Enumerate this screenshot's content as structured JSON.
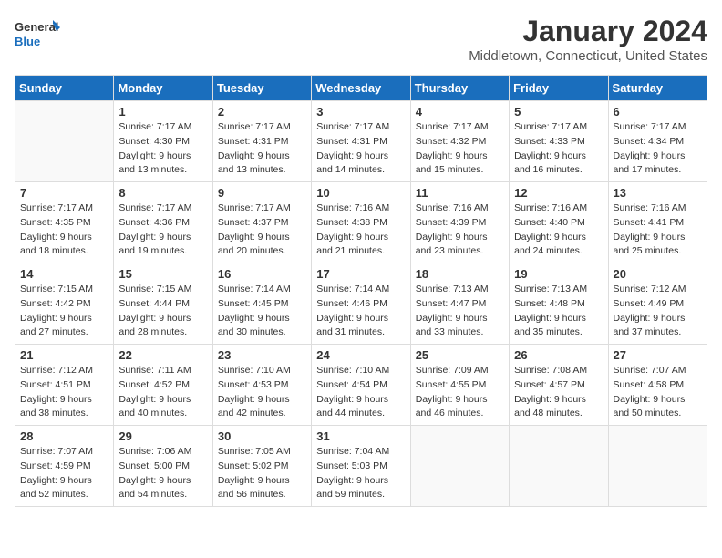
{
  "header": {
    "logo_line1": "General",
    "logo_line2": "Blue",
    "month": "January 2024",
    "location": "Middletown, Connecticut, United States"
  },
  "days_of_week": [
    "Sunday",
    "Monday",
    "Tuesday",
    "Wednesday",
    "Thursday",
    "Friday",
    "Saturday"
  ],
  "weeks": [
    [
      {
        "day": "",
        "empty": true
      },
      {
        "day": "1",
        "sunrise": "7:17 AM",
        "sunset": "4:30 PM",
        "daylight": "9 hours and 13 minutes."
      },
      {
        "day": "2",
        "sunrise": "7:17 AM",
        "sunset": "4:31 PM",
        "daylight": "9 hours and 13 minutes."
      },
      {
        "day": "3",
        "sunrise": "7:17 AM",
        "sunset": "4:31 PM",
        "daylight": "9 hours and 14 minutes."
      },
      {
        "day": "4",
        "sunrise": "7:17 AM",
        "sunset": "4:32 PM",
        "daylight": "9 hours and 15 minutes."
      },
      {
        "day": "5",
        "sunrise": "7:17 AM",
        "sunset": "4:33 PM",
        "daylight": "9 hours and 16 minutes."
      },
      {
        "day": "6",
        "sunrise": "7:17 AM",
        "sunset": "4:34 PM",
        "daylight": "9 hours and 17 minutes."
      }
    ],
    [
      {
        "day": "7",
        "sunrise": "7:17 AM",
        "sunset": "4:35 PM",
        "daylight": "9 hours and 18 minutes."
      },
      {
        "day": "8",
        "sunrise": "7:17 AM",
        "sunset": "4:36 PM",
        "daylight": "9 hours and 19 minutes."
      },
      {
        "day": "9",
        "sunrise": "7:17 AM",
        "sunset": "4:37 PM",
        "daylight": "9 hours and 20 minutes."
      },
      {
        "day": "10",
        "sunrise": "7:16 AM",
        "sunset": "4:38 PM",
        "daylight": "9 hours and 21 minutes."
      },
      {
        "day": "11",
        "sunrise": "7:16 AM",
        "sunset": "4:39 PM",
        "daylight": "9 hours and 23 minutes."
      },
      {
        "day": "12",
        "sunrise": "7:16 AM",
        "sunset": "4:40 PM",
        "daylight": "9 hours and 24 minutes."
      },
      {
        "day": "13",
        "sunrise": "7:16 AM",
        "sunset": "4:41 PM",
        "daylight": "9 hours and 25 minutes."
      }
    ],
    [
      {
        "day": "14",
        "sunrise": "7:15 AM",
        "sunset": "4:42 PM",
        "daylight": "9 hours and 27 minutes."
      },
      {
        "day": "15",
        "sunrise": "7:15 AM",
        "sunset": "4:44 PM",
        "daylight": "9 hours and 28 minutes."
      },
      {
        "day": "16",
        "sunrise": "7:14 AM",
        "sunset": "4:45 PM",
        "daylight": "9 hours and 30 minutes."
      },
      {
        "day": "17",
        "sunrise": "7:14 AM",
        "sunset": "4:46 PM",
        "daylight": "9 hours and 31 minutes."
      },
      {
        "day": "18",
        "sunrise": "7:13 AM",
        "sunset": "4:47 PM",
        "daylight": "9 hours and 33 minutes."
      },
      {
        "day": "19",
        "sunrise": "7:13 AM",
        "sunset": "4:48 PM",
        "daylight": "9 hours and 35 minutes."
      },
      {
        "day": "20",
        "sunrise": "7:12 AM",
        "sunset": "4:49 PM",
        "daylight": "9 hours and 37 minutes."
      }
    ],
    [
      {
        "day": "21",
        "sunrise": "7:12 AM",
        "sunset": "4:51 PM",
        "daylight": "9 hours and 38 minutes."
      },
      {
        "day": "22",
        "sunrise": "7:11 AM",
        "sunset": "4:52 PM",
        "daylight": "9 hours and 40 minutes."
      },
      {
        "day": "23",
        "sunrise": "7:10 AM",
        "sunset": "4:53 PM",
        "daylight": "9 hours and 42 minutes."
      },
      {
        "day": "24",
        "sunrise": "7:10 AM",
        "sunset": "4:54 PM",
        "daylight": "9 hours and 44 minutes."
      },
      {
        "day": "25",
        "sunrise": "7:09 AM",
        "sunset": "4:55 PM",
        "daylight": "9 hours and 46 minutes."
      },
      {
        "day": "26",
        "sunrise": "7:08 AM",
        "sunset": "4:57 PM",
        "daylight": "9 hours and 48 minutes."
      },
      {
        "day": "27",
        "sunrise": "7:07 AM",
        "sunset": "4:58 PM",
        "daylight": "9 hours and 50 minutes."
      }
    ],
    [
      {
        "day": "28",
        "sunrise": "7:07 AM",
        "sunset": "4:59 PM",
        "daylight": "9 hours and 52 minutes."
      },
      {
        "day": "29",
        "sunrise": "7:06 AM",
        "sunset": "5:00 PM",
        "daylight": "9 hours and 54 minutes."
      },
      {
        "day": "30",
        "sunrise": "7:05 AM",
        "sunset": "5:02 PM",
        "daylight": "9 hours and 56 minutes."
      },
      {
        "day": "31",
        "sunrise": "7:04 AM",
        "sunset": "5:03 PM",
        "daylight": "9 hours and 59 minutes."
      },
      {
        "day": "",
        "empty": true
      },
      {
        "day": "",
        "empty": true
      },
      {
        "day": "",
        "empty": true
      }
    ]
  ]
}
